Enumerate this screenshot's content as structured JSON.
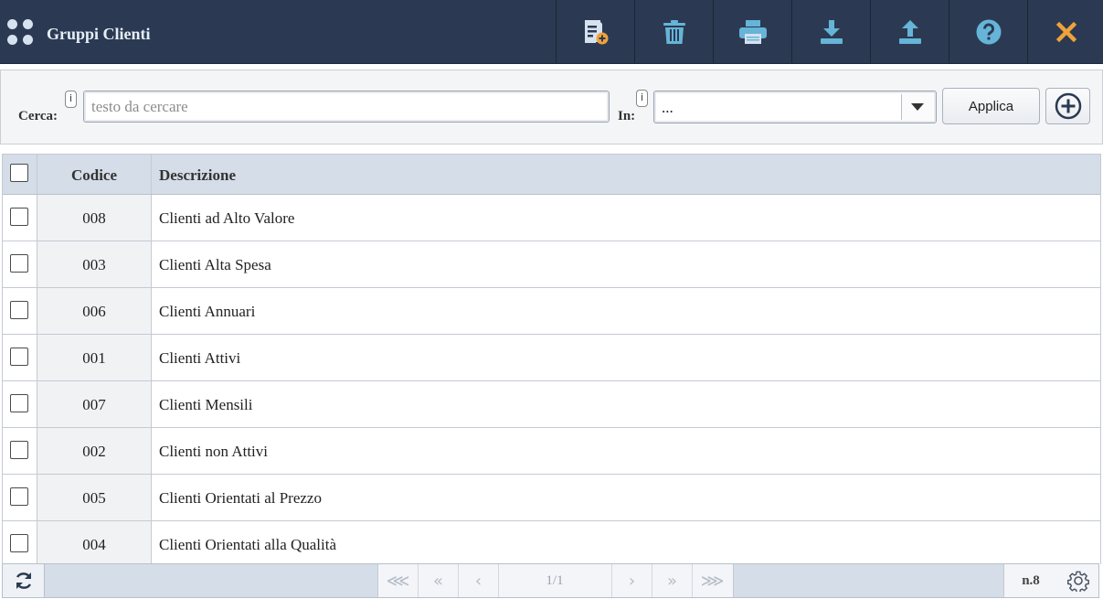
{
  "app": {
    "title": "Gruppi Clienti",
    "icon": "apps-grid-icon"
  },
  "toolbar": {
    "buttons": [
      {
        "name": "new-document-button",
        "icon": "document-add-icon",
        "color": "#d6e2f0"
      },
      {
        "name": "delete-button",
        "icon": "trash-icon",
        "color": "#66b4d8"
      },
      {
        "name": "print-button",
        "icon": "printer-icon",
        "color": "#66b4d8"
      },
      {
        "name": "download-button",
        "icon": "download-icon",
        "color": "#66b4d8"
      },
      {
        "name": "upload-button",
        "icon": "upload-icon",
        "color": "#66b4d8"
      },
      {
        "name": "help-button",
        "icon": "help-icon",
        "color": "#66b4d8"
      },
      {
        "name": "close-button",
        "icon": "close-icon",
        "color": "#f0a23a"
      }
    ]
  },
  "search": {
    "label": "Cerca:",
    "info": "i",
    "placeholder": "testo da cercare",
    "value": "",
    "in_label": "In:",
    "in_value": "...",
    "apply_label": "Applica"
  },
  "grid": {
    "columns": [
      "Codice",
      "Descrizione"
    ],
    "rows": [
      {
        "code": "008",
        "description": "Clienti ad Alto Valore"
      },
      {
        "code": "003",
        "description": "Clienti Alta Spesa"
      },
      {
        "code": "006",
        "description": "Clienti Annuari"
      },
      {
        "code": "001",
        "description": "Clienti Attivi"
      },
      {
        "code": "007",
        "description": "Clienti Mensili"
      },
      {
        "code": "002",
        "description": "Clienti non Attivi"
      },
      {
        "code": "005",
        "description": "Clienti Orientati al Prezzo"
      },
      {
        "code": "004",
        "description": "Clienti Orientati alla Qualità"
      }
    ]
  },
  "footer": {
    "page_info": "1/1",
    "count": "n.8",
    "pager": [
      "⋘",
      "«",
      "‹",
      "›",
      "»",
      "⋙"
    ]
  },
  "colors": {
    "topbar": "#2b3a52",
    "header": "#d5dde8",
    "accent": "#66b4d8",
    "close": "#f0a23a"
  }
}
